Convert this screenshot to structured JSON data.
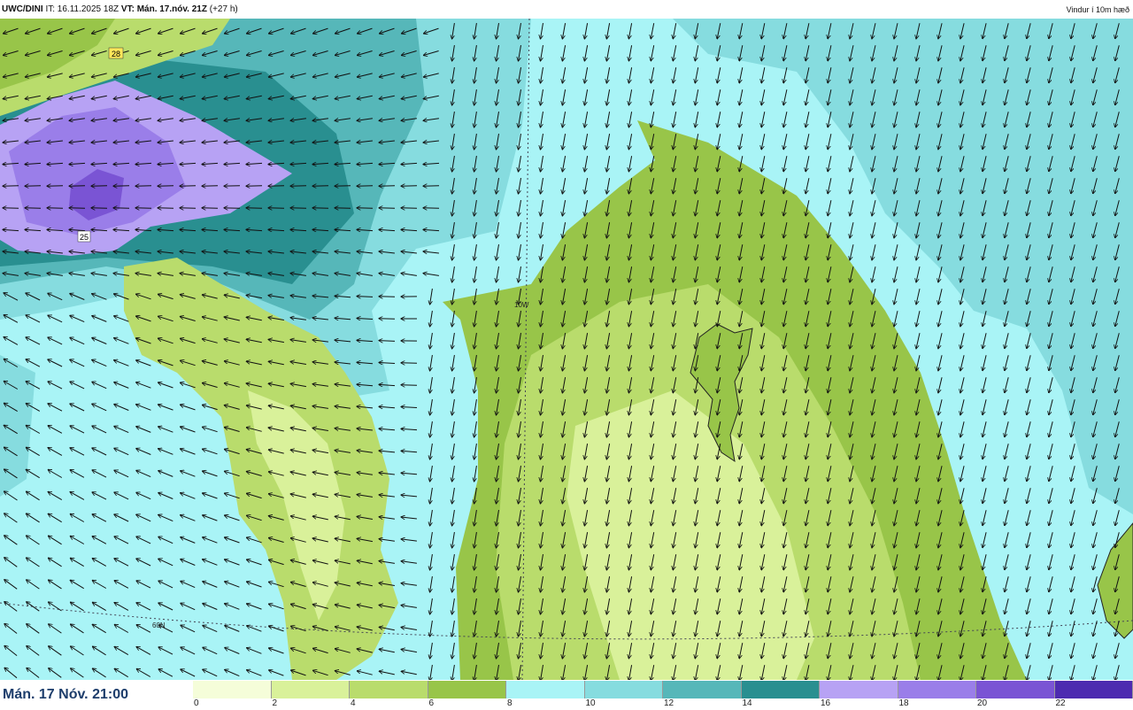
{
  "header": {
    "product": "UWC/DINI",
    "it_label": "IT:",
    "it_value": "16.11.2025 18Z",
    "vt_label": "VT:",
    "vt_value": "Mán. 17.nóv. 21Z",
    "lead": "(+27 h)",
    "field_name": "Vindur í 10m hæð"
  },
  "map": {
    "markers": [
      "28",
      "25"
    ],
    "lon_label": "10W",
    "lat_label": "60N"
  },
  "footer": {
    "date_label": "Mán. 17 Nóv. 21:00"
  },
  "legend": {
    "ticks": [
      "0",
      "2",
      "4",
      "6",
      "8",
      "10",
      "12",
      "14",
      "16",
      "18",
      "20",
      "22"
    ],
    "colors": [
      "#f5fdd9",
      "#d9f19a",
      "#b9dc6c",
      "#98c549",
      "#a9f4f6",
      "#86dcdf",
      "#56b7b9",
      "#298f90",
      "#b7a2f4",
      "#9a7ee9",
      "#7a54d4",
      "#4d2bb0"
    ]
  }
}
